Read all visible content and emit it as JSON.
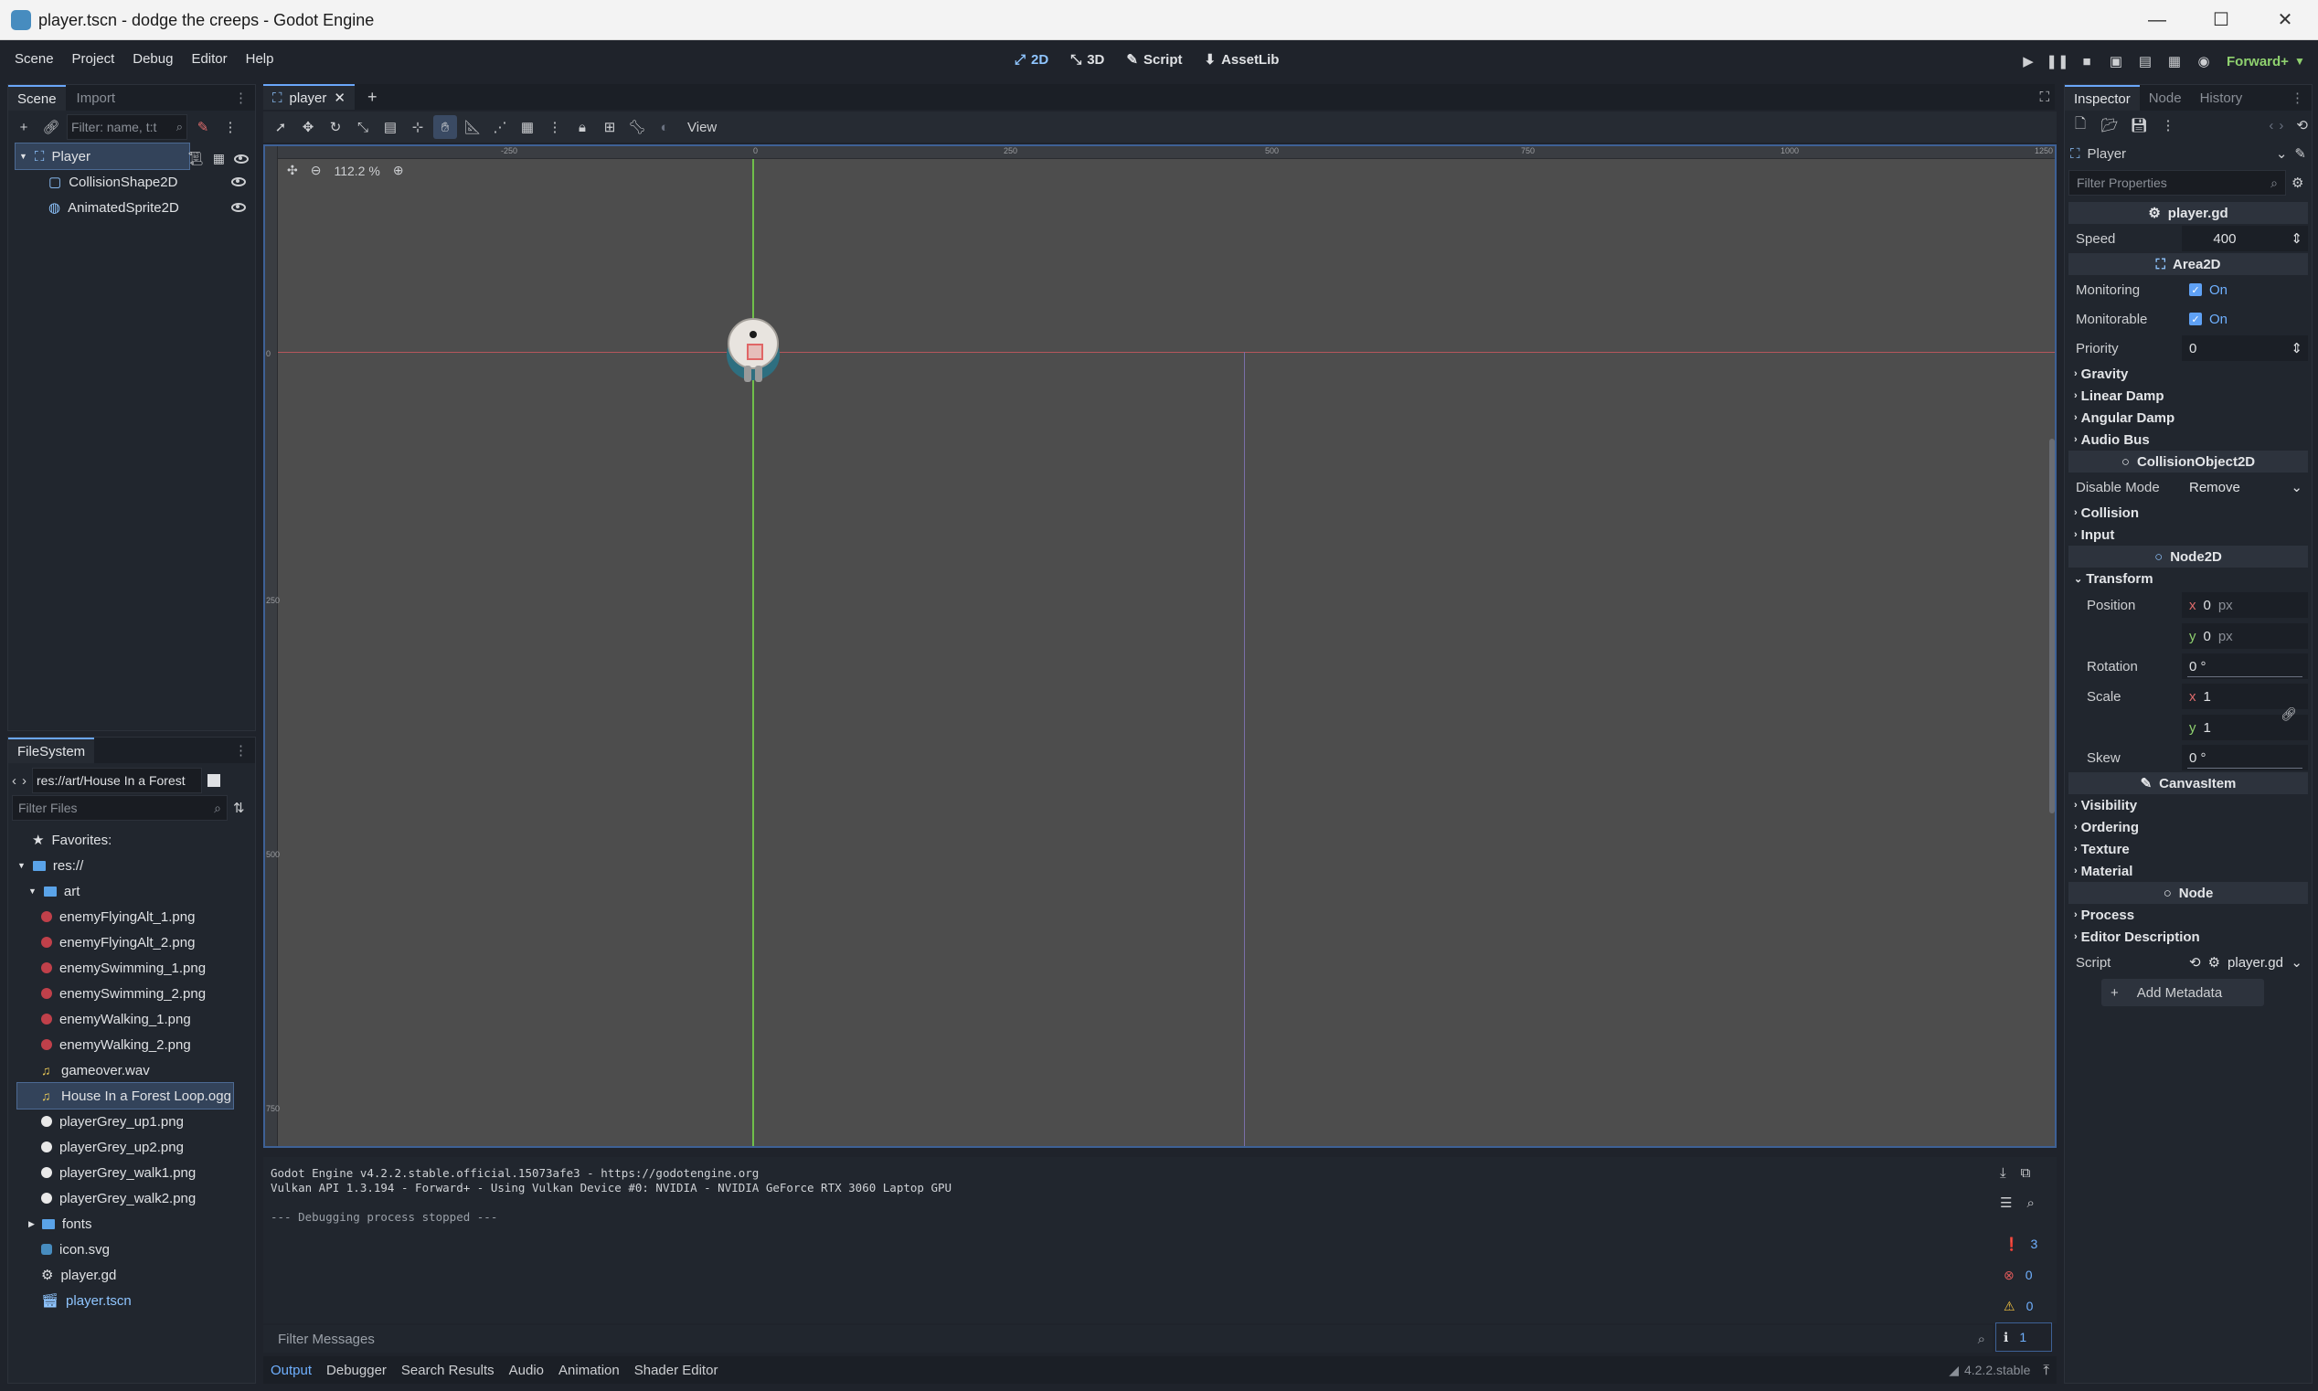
{
  "window": {
    "title": "player.tscn - dodge the creeps - Godot Engine",
    "minimize": "—",
    "maximize": "☐",
    "close": "✕"
  },
  "menubar": {
    "items": [
      "Scene",
      "Project",
      "Debug",
      "Editor",
      "Help"
    ],
    "workspaces": [
      {
        "label": "2D",
        "icon": "2d-icon",
        "active": true
      },
      {
        "label": "3D",
        "icon": "3d-icon",
        "active": false
      },
      {
        "label": "Script",
        "icon": "script-icon",
        "active": false
      },
      {
        "label": "AssetLib",
        "icon": "assetlib-icon",
        "active": false
      }
    ],
    "renderer": "Forward+"
  },
  "scene_dock": {
    "tabs": [
      "Scene",
      "Import"
    ],
    "filter_placeholder": "Filter: name, t:t",
    "nodes": [
      {
        "label": "Player",
        "icon": "area2d-icon",
        "selected": true
      },
      {
        "label": "CollisionShape2D",
        "icon": "collisionshape-icon",
        "selected": false
      },
      {
        "label": "AnimatedSprite2D",
        "icon": "animatedsprite-icon",
        "selected": false
      }
    ]
  },
  "filesystem_dock": {
    "tab": "FileSystem",
    "path": "res://art/House In a Forest",
    "filter_placeholder": "Filter Files",
    "favorites": "Favorites:",
    "root": "res://",
    "art_folder": "art",
    "art_files": [
      {
        "label": "enemyFlyingAlt_1.png",
        "icon": "enemy-image-icon"
      },
      {
        "label": "enemyFlyingAlt_2.png",
        "icon": "enemy-image-icon"
      },
      {
        "label": "enemySwimming_1.png",
        "icon": "enemy-image-icon"
      },
      {
        "label": "enemySwimming_2.png",
        "icon": "enemy-image-icon"
      },
      {
        "label": "enemyWalking_1.png",
        "icon": "enemy-image-icon"
      },
      {
        "label": "enemyWalking_2.png",
        "icon": "enemy-image-icon"
      },
      {
        "label": "gameover.wav",
        "icon": "audio-icon"
      },
      {
        "label": "House In a Forest Loop.ogg",
        "icon": "audio-icon",
        "selected": true
      },
      {
        "label": "playerGrey_up1.png",
        "icon": "player-image-icon"
      },
      {
        "label": "playerGrey_up2.png",
        "icon": "player-image-icon"
      },
      {
        "label": "playerGrey_walk1.png",
        "icon": "player-image-icon"
      },
      {
        "label": "playerGrey_walk2.png",
        "icon": "player-image-icon"
      }
    ],
    "other": [
      {
        "label": "fonts",
        "icon": "folder-icon"
      },
      {
        "label": "icon.svg",
        "icon": "svg-icon"
      },
      {
        "label": "player.gd",
        "icon": "gear-icon"
      },
      {
        "label": "player.tscn",
        "icon": "scene-icon"
      }
    ]
  },
  "viewport": {
    "scene_tab": "player",
    "view_menu": "View",
    "zoom": "112.2 %",
    "ruler_h": [
      "-250",
      "0",
      "250",
      "500",
      "750",
      "1000",
      "1250"
    ],
    "ruler_v": [
      "0",
      "250",
      "500",
      "750"
    ]
  },
  "output": {
    "lines": [
      "Godot Engine v4.2.2.stable.official.15073afe3 - https://godotengine.org",
      "Vulkan API 1.3.194 - Forward+ - Using Vulkan Device #0: NVIDIA - NVIDIA GeForce RTX 3060 Laptop GPU",
      "",
      "--- Debugging process stopped ---"
    ],
    "filter_placeholder": "Filter Messages",
    "counts": {
      "log": "3",
      "errors": "0",
      "warnings": "0",
      "info": "1"
    },
    "tabs": [
      "Output",
      "Debugger",
      "Search Results",
      "Audio",
      "Animation",
      "Shader Editor"
    ],
    "version": "4.2.2.stable"
  },
  "inspector": {
    "tabs": [
      "Inspector",
      "Node",
      "History"
    ],
    "node_name": "Player",
    "filter_placeholder": "Filter Properties",
    "script_section": "player.gd",
    "speed_label": "Speed",
    "speed_value": "400",
    "area2d_section": "Area2D",
    "monitoring_label": "Monitoring",
    "monitoring_value": "On",
    "monitorable_label": "Monitorable",
    "monitorable_value": "On",
    "priority_label": "Priority",
    "priority_value": "0",
    "area_groups": [
      "Gravity",
      "Linear Damp",
      "Angular Damp",
      "Audio Bus"
    ],
    "collision_section": "CollisionObject2D",
    "disable_mode_label": "Disable Mode",
    "disable_mode_value": "Remove",
    "collision_groups": [
      "Collision",
      "Input"
    ],
    "node2d_section": "Node2D",
    "transform_group": "Transform",
    "position_label": "Position",
    "pos_x": "0",
    "pos_y": "0",
    "px_unit": "px",
    "rotation_label": "Rotation",
    "rotation_value": "0 °",
    "scale_label": "Scale",
    "scale_x": "1",
    "scale_y": "1",
    "skew_label": "Skew",
    "skew_value": "0 °",
    "canvasitem_section": "CanvasItem",
    "canvas_groups": [
      "Visibility",
      "Ordering",
      "Texture",
      "Material"
    ],
    "node_section": "Node",
    "node_groups": [
      "Process",
      "Editor Description"
    ],
    "script_label": "Script",
    "script_value": "player.gd",
    "add_metadata": "Add Metadata",
    "x_axis": "x",
    "y_axis": "y"
  }
}
